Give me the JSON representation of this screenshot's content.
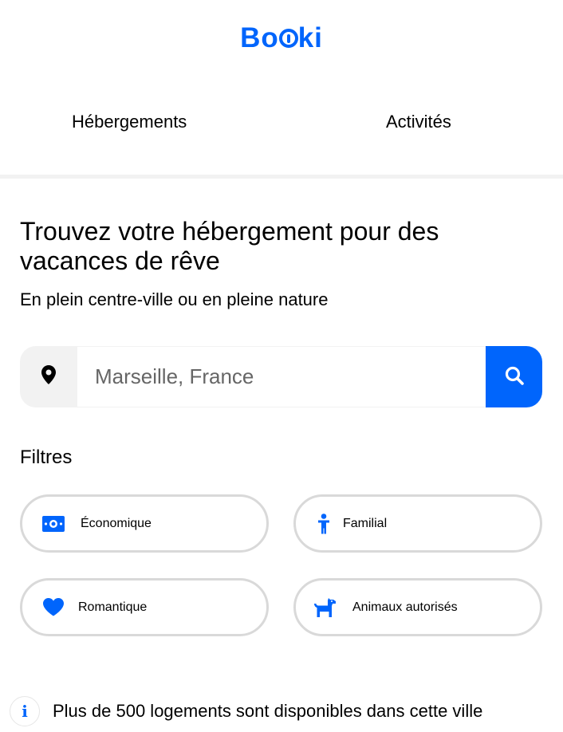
{
  "header": {
    "logo_text_left": "Bo",
    "logo_text_right": "ki"
  },
  "nav": {
    "tabs": [
      {
        "label": "Hébergements"
      },
      {
        "label": "Activités"
      }
    ]
  },
  "hero": {
    "title": "Trouvez votre hébergement pour des vacances de rêve",
    "subtitle": "En plein centre-ville ou en pleine nature"
  },
  "search": {
    "placeholder": "Marseille, France",
    "location_icon": "map-pin-icon",
    "search_icon": "magnifier-icon"
  },
  "filters": {
    "title": "Filtres",
    "items": [
      {
        "label": "Économique",
        "icon": "money-bill-icon"
      },
      {
        "label": "Familial",
        "icon": "child-icon"
      },
      {
        "label": "Romantique",
        "icon": "heart-icon"
      },
      {
        "label": "Animaux autorisés",
        "icon": "dog-icon"
      }
    ]
  },
  "info": {
    "icon_glyph": "i",
    "text": "Plus de 500 logements sont disponibles dans cette ville"
  },
  "colors": {
    "accent": "#0065FC",
    "chip_border": "#D9D9D9",
    "light_bg": "#F2F2F2"
  }
}
